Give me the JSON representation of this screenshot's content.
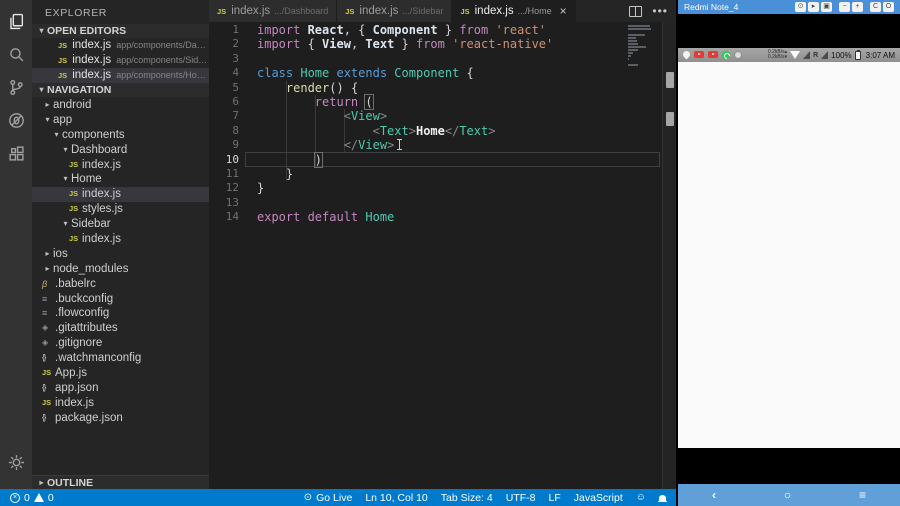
{
  "activity_bar": {
    "items": [
      "explorer",
      "search",
      "source-control",
      "debug",
      "extensions"
    ],
    "bottom": [
      "settings"
    ]
  },
  "sidebar": {
    "title": "EXPLORER",
    "open_editors": {
      "label": "OPEN EDITORS",
      "items": [
        {
          "name": "index.js",
          "path": "app/components/Dashbo...",
          "selected": false
        },
        {
          "name": "index.js",
          "path": "app/components/Sidebar",
          "selected": false
        },
        {
          "name": "index.js",
          "path": "app/components/Home",
          "selected": true
        }
      ]
    },
    "navigation": {
      "label": "NAVIGATION",
      "tree": [
        {
          "label": "android",
          "level": 0,
          "twisty": "closed"
        },
        {
          "label": "app",
          "level": 0,
          "twisty": "open"
        },
        {
          "label": "components",
          "level": 1,
          "twisty": "open"
        },
        {
          "label": "Dashboard",
          "level": 2,
          "twisty": "open"
        },
        {
          "label": "index.js",
          "level": 3,
          "icon": "js"
        },
        {
          "label": "Home",
          "level": 2,
          "twisty": "open"
        },
        {
          "label": "index.js",
          "level": 3,
          "icon": "js",
          "selected": true
        },
        {
          "label": "styles.js",
          "level": 3,
          "icon": "js"
        },
        {
          "label": "Sidebar",
          "level": 2,
          "twisty": "open"
        },
        {
          "label": "index.js",
          "level": 3,
          "icon": "js"
        },
        {
          "label": "ios",
          "level": 0,
          "twisty": "closed"
        },
        {
          "label": "node_modules",
          "level": 0,
          "twisty": "closed"
        },
        {
          "label": ".babelrc",
          "level": 0,
          "icon": "babel"
        },
        {
          "label": ".buckconfig",
          "level": 0,
          "icon": "config"
        },
        {
          "label": ".flowconfig",
          "level": 0,
          "icon": "config"
        },
        {
          "label": ".gitattributes",
          "level": 0,
          "icon": "git"
        },
        {
          "label": ".gitignore",
          "level": 0,
          "icon": "git"
        },
        {
          "label": ".watchmanconfig",
          "level": 0,
          "icon": "json"
        },
        {
          "label": "App.js",
          "level": 0,
          "icon": "js"
        },
        {
          "label": "app.json",
          "level": 0,
          "icon": "json"
        },
        {
          "label": "index.js",
          "level": 0,
          "icon": "js"
        },
        {
          "label": "package.json",
          "level": 0,
          "icon": "json"
        }
      ]
    },
    "outline_label": "OUTLINE"
  },
  "editor": {
    "tabs": [
      {
        "name": "index.js",
        "path": ".../Dashboard",
        "active": false
      },
      {
        "name": "index.js",
        "path": ".../Sidebar",
        "active": false
      },
      {
        "name": "index.js",
        "path": ".../Home",
        "active": true,
        "close": "×"
      }
    ],
    "lines": [
      {
        "n": 1,
        "tokens": [
          [
            "k",
            "import "
          ],
          [
            "v",
            "React"
          ],
          [
            "p",
            ", "
          ],
          [
            "p",
            "{ "
          ],
          [
            "v",
            "Component"
          ],
          [
            "p",
            " } "
          ],
          [
            "k",
            "from "
          ],
          [
            "s",
            "'react'"
          ]
        ]
      },
      {
        "n": 2,
        "tokens": [
          [
            "k",
            "import "
          ],
          [
            "p",
            "{ "
          ],
          [
            "v",
            "View"
          ],
          [
            "p",
            ", "
          ],
          [
            "v",
            "Text"
          ],
          [
            "p",
            " } "
          ],
          [
            "k",
            "from "
          ],
          [
            "s",
            "'react-native'"
          ]
        ]
      },
      {
        "n": 3,
        "tokens": []
      },
      {
        "n": 4,
        "tokens": [
          [
            "kb",
            "class "
          ],
          [
            "t",
            "Home "
          ],
          [
            "kb",
            "extends "
          ],
          [
            "t",
            "Component "
          ],
          [
            "p",
            "{"
          ]
        ]
      },
      {
        "n": 5,
        "tokens": [
          [
            "p",
            "    "
          ],
          [
            "f",
            "render"
          ],
          [
            "p",
            "() {"
          ]
        ]
      },
      {
        "n": 6,
        "tokens": [
          [
            "p",
            "        "
          ],
          [
            "k",
            "return "
          ],
          [
            "bx",
            "("
          ]
        ]
      },
      {
        "n": 7,
        "tokens": [
          [
            "p",
            "            "
          ],
          [
            "a",
            "<"
          ],
          [
            "t",
            "View"
          ],
          [
            "a",
            ">"
          ]
        ]
      },
      {
        "n": 8,
        "tokens": [
          [
            "p",
            "                "
          ],
          [
            "a",
            "<"
          ],
          [
            "t",
            "Text"
          ],
          [
            "a",
            ">"
          ],
          [
            "w",
            "Home"
          ],
          [
            "a",
            "</"
          ],
          [
            "t",
            "Text"
          ],
          [
            "a",
            ">"
          ]
        ]
      },
      {
        "n": 9,
        "tokens": [
          [
            "p",
            "            "
          ],
          [
            "a",
            "</"
          ],
          [
            "t",
            "View"
          ],
          [
            "a",
            ">"
          ],
          [
            "cur",
            ""
          ]
        ]
      },
      {
        "n": 10,
        "tokens": [
          [
            "p",
            "        "
          ],
          [
            "bx",
            ")"
          ]
        ],
        "current": true
      },
      {
        "n": 11,
        "tokens": [
          [
            "p",
            "    "
          ],
          [
            "p",
            "}"
          ]
        ]
      },
      {
        "n": 12,
        "tokens": [
          [
            "p",
            "}"
          ]
        ]
      },
      {
        "n": 13,
        "tokens": []
      },
      {
        "n": 14,
        "tokens": [
          [
            "k",
            "export "
          ],
          [
            "k",
            "default "
          ],
          [
            "t",
            "Home"
          ]
        ]
      }
    ]
  },
  "status_bar": {
    "colors": {
      "background": "#007ACC"
    },
    "left": [
      {
        "icon": "error",
        "value": "0"
      },
      {
        "icon": "warning",
        "value": "0"
      }
    ],
    "right": [
      {
        "icon": "broadcast",
        "label": "Go Live"
      },
      {
        "label": "Ln 10, Col 10"
      },
      {
        "label": "Tab Size: 4"
      },
      {
        "label": "UTF-8"
      },
      {
        "label": "LF"
      },
      {
        "label": "JavaScript"
      },
      {
        "icon": "smiley",
        "label": ""
      },
      {
        "icon": "bell",
        "label": ""
      }
    ]
  },
  "phone": {
    "window_title": "Redmi Note_4",
    "toolbar_buttons": [
      {
        "name": "cast",
        "glyph": "⊙"
      },
      {
        "name": "record",
        "glyph": "▸"
      },
      {
        "name": "screenshot",
        "glyph": "▣"
      },
      {
        "name": "volume-down",
        "glyph": "−"
      },
      {
        "name": "volume-up",
        "glyph": "+"
      },
      {
        "name": "rotate",
        "glyph": "C"
      },
      {
        "name": "power",
        "glyph": "O"
      }
    ],
    "status_bar": {
      "left_icons": [
        "location",
        "youtube",
        "youtube",
        "whatsapp",
        "circle"
      ],
      "net_up": "0.2kB/s",
      "net_down": "0.2kB/s",
      "roaming": "R",
      "battery": "100%",
      "time": "3:07 AM"
    },
    "nav": [
      {
        "name": "back",
        "glyph": "‹"
      },
      {
        "name": "home",
        "glyph": "○"
      },
      {
        "name": "recents",
        "glyph": "≡"
      }
    ]
  }
}
